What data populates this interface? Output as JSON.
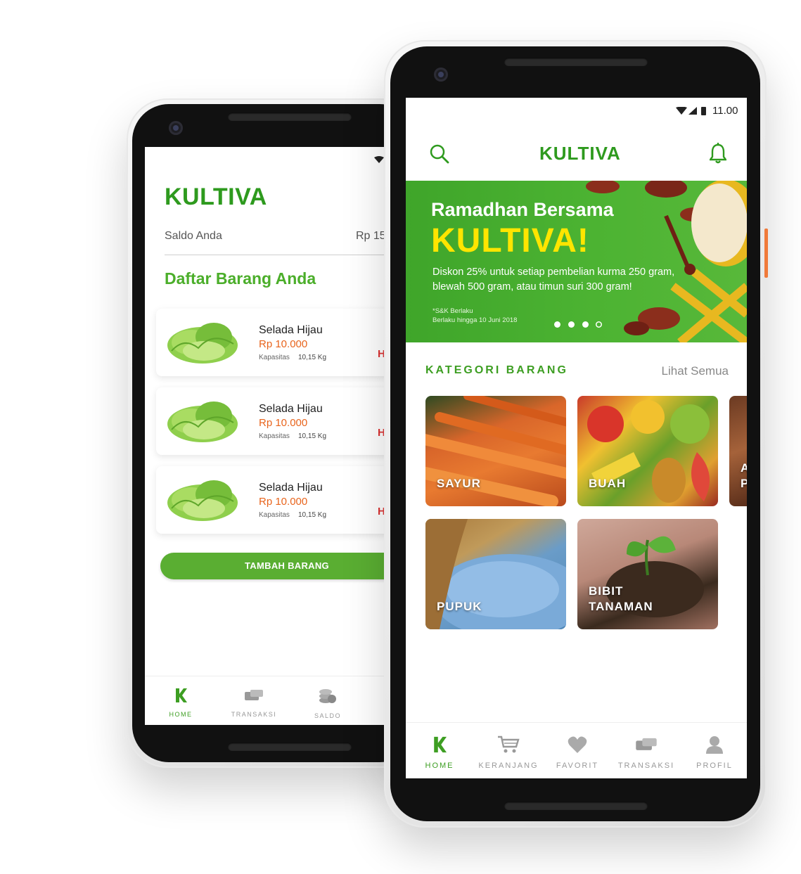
{
  "back_phone": {
    "app_name": "KULTIVA",
    "saldo_label": "Saldo Anda",
    "saldo_value": "Rp 15",
    "section_title": "Daftar Barang Anda",
    "items": [
      {
        "name": "Selada Hijau",
        "price": "Rp 10.000",
        "capacity_label": "Kapasitas",
        "capacity_value": "10,15 Kg",
        "edge": "H"
      },
      {
        "name": "Selada Hijau",
        "price": "Rp 10.000",
        "capacity_label": "Kapasitas",
        "capacity_value": "10,15 Kg",
        "edge": "H"
      },
      {
        "name": "Selada Hijau",
        "price": "Rp 10.000",
        "capacity_label": "Kapasitas",
        "capacity_value": "10,15 Kg",
        "edge": "H"
      }
    ],
    "add_button": "TAMBAH BARANG",
    "nav": [
      {
        "label": "HOME",
        "icon": "k-logo-icon",
        "active": true
      },
      {
        "label": "TRANSAKSI",
        "icon": "wallet-icon",
        "active": false
      },
      {
        "label": "SALDO",
        "icon": "coins-icon",
        "active": false
      }
    ]
  },
  "front_phone": {
    "status_time": "11.00",
    "app_name": "KULTIVA",
    "banner": {
      "headline": "Ramadhan Bersama",
      "brand": "KULTIVA!",
      "description": "Diskon 25% untuk setiap pembelian kurma 250 gram, blewah 500 gram, atau timun suri 300 gram!",
      "terms": "*S&K Berlaku",
      "valid_until": "Berlaku hingga 10 Juni 2018",
      "slides_total": 4,
      "slide_active": 3
    },
    "category_title": "KATEGORI BARANG",
    "see_all": "Lihat Semua",
    "categories": [
      {
        "label": "SAYUR"
      },
      {
        "label": "BUAH"
      },
      {
        "label": "A\nP"
      },
      {
        "label": "PUPUK"
      },
      {
        "label": "BIBIT\nTANAMAN"
      }
    ],
    "nav": [
      {
        "label": "HOME",
        "icon": "k-logo-icon",
        "active": true
      },
      {
        "label": "KERANJANG",
        "icon": "cart-icon",
        "active": false
      },
      {
        "label": "FAVORIT",
        "icon": "heart-icon",
        "active": false
      },
      {
        "label": "TRANSAKSI",
        "icon": "wallet-icon",
        "active": false
      },
      {
        "label": "PROFIL",
        "icon": "user-icon",
        "active": false
      }
    ]
  },
  "colors": {
    "brand_green": "#2e9a1e",
    "accent_green": "#4bae2a",
    "price_orange": "#e8641c",
    "banner_yellow": "#ffe500"
  }
}
